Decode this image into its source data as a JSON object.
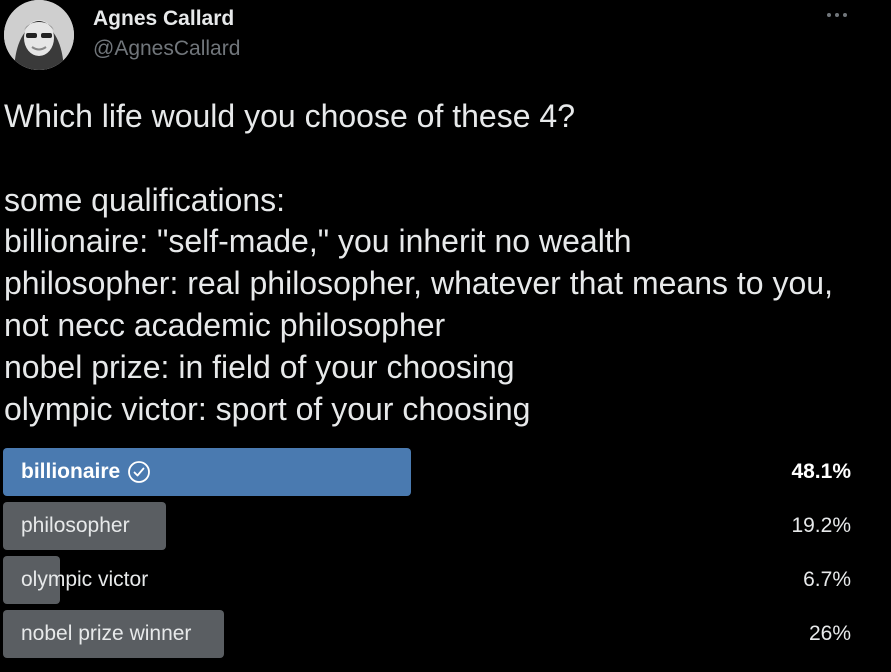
{
  "author": {
    "name": "Agnes Callard",
    "handle": "@AgnesCallard",
    "avatar_icon": "profile-photo"
  },
  "menu": {
    "more_icon": "more-horizontal-icon"
  },
  "tweet": {
    "text": "Which life would you choose of these 4?\n\nsome qualifications:\nbillionaire: \"self-made,\" you inherit no wealth\nphilosopher: real philosopher, whatever that means to you, not necc academic philosopher\nnobel prize: in field of your choosing\nolympic victor: sport of your choosing"
  },
  "poll": {
    "options": [
      {
        "label": "billionaire",
        "percent_text": "48.1%",
        "percent": 48.1,
        "winner": true,
        "check_icon": "check-circle-icon"
      },
      {
        "label": "philosopher",
        "percent_text": "19.2%",
        "percent": 19.2,
        "winner": false
      },
      {
        "label": "olympic victor",
        "percent_text": "6.7%",
        "percent": 6.7,
        "winner": false
      },
      {
        "label": "nobel prize winner",
        "percent_text": "26%",
        "percent": 26,
        "winner": false
      }
    ]
  },
  "colors": {
    "background": "#000000",
    "text": "#e7e9ea",
    "secondary_text": "#71767b",
    "winner_bar": "#4a7ab0",
    "option_bar": "#5a5e62"
  }
}
